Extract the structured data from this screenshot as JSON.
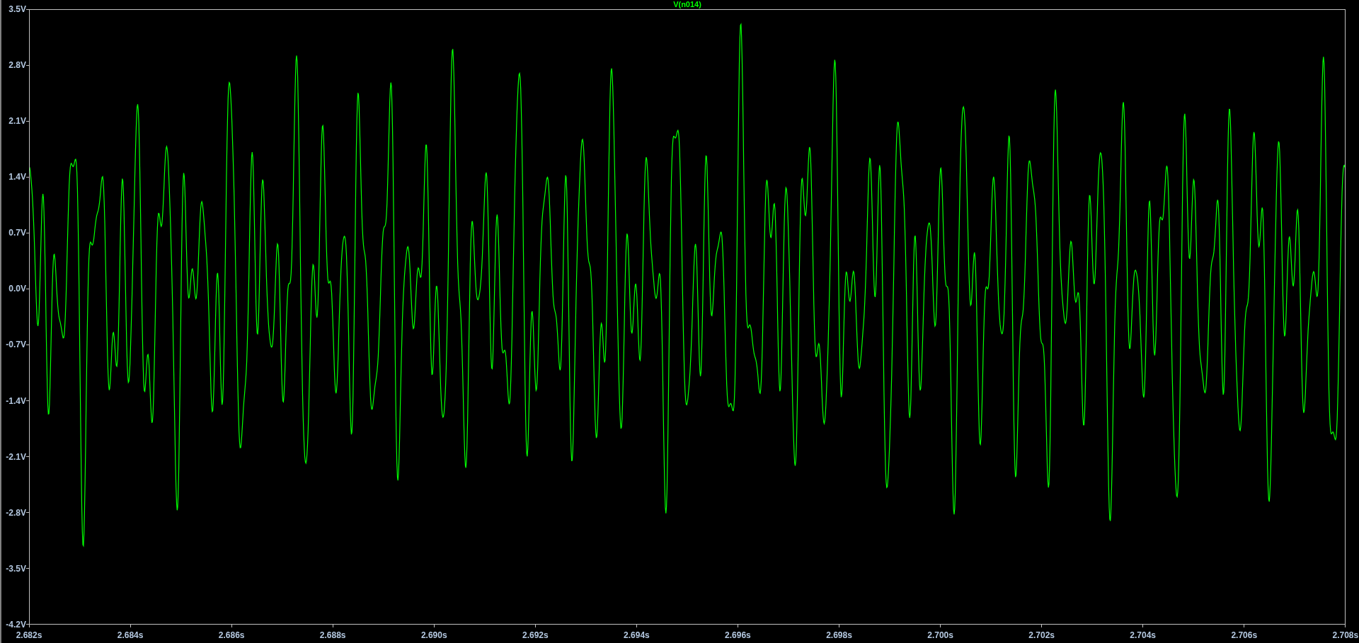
{
  "plot": {
    "title": "V(n014)",
    "y_ticks": [
      "3.5V",
      "2.8V",
      "2.1V",
      "1.4V",
      "0.7V",
      "0.0V",
      "-0.7V",
      "-1.4V",
      "-2.1V",
      "-2.8V",
      "-3.5V",
      "-4.2V"
    ],
    "x_ticks": [
      "2.682s",
      "2.684s",
      "2.686s",
      "2.688s",
      "2.690s",
      "2.692s",
      "2.694s",
      "2.696s",
      "2.698s",
      "2.700s",
      "2.702s",
      "2.704s",
      "2.706s",
      "2.708s"
    ]
  }
}
